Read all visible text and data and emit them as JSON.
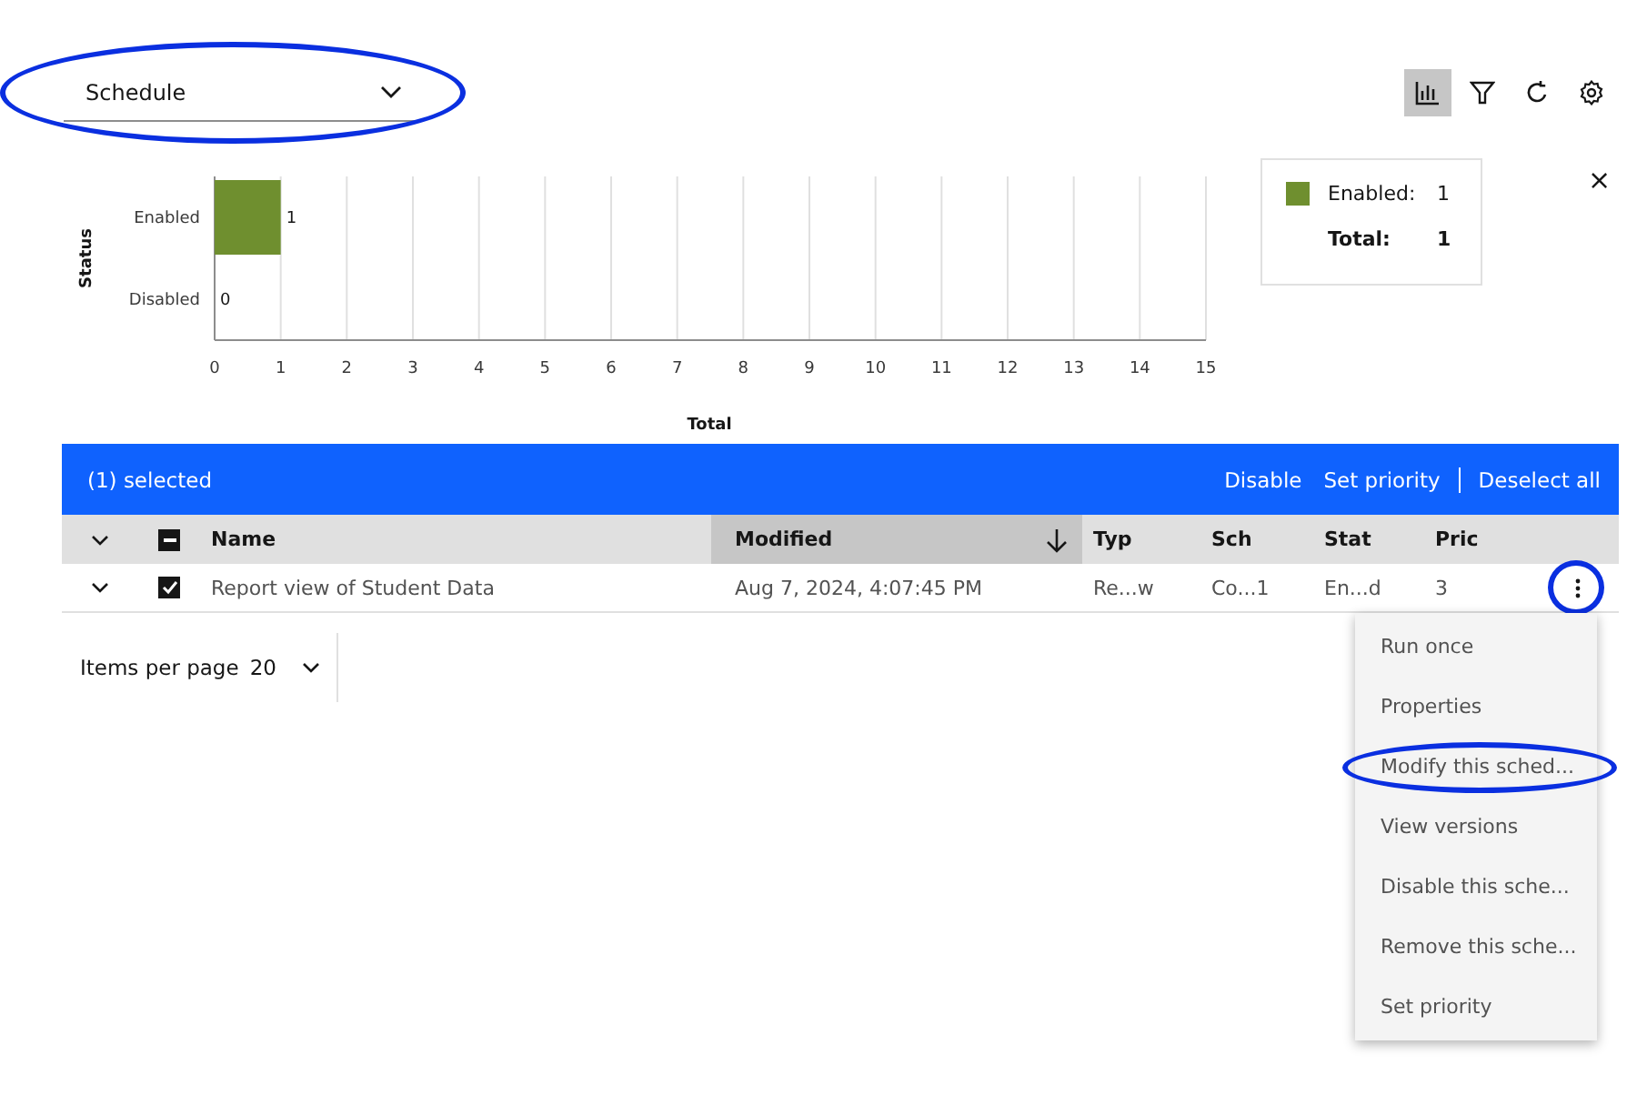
{
  "dropdown": {
    "value": "Schedule",
    "highlighted": true
  },
  "toolbar": [
    {
      "selected": true
    },
    {
      "selected": false
    },
    {
      "selected": false
    },
    {
      "selected": false
    }
  ],
  "chart": {
    "chart_data": {
      "type": "bar",
      "orientation": "horizontal",
      "xlabel": "Total",
      "ylabel": "Status",
      "categories": [
        "Enabled",
        "Disabled"
      ],
      "series": [
        {
          "color": "#6f8f2f",
          "values": [
            1,
            0
          ]
        }
      ],
      "grid": true,
      "xlim": [
        0,
        15
      ],
      "xticks": [
        0,
        1,
        2,
        3,
        4,
        5,
        6,
        7,
        8,
        9,
        10,
        11,
        12,
        13,
        14,
        15
      ],
      "data_labels": true
    }
  },
  "legend": {
    "items": [
      {
        "label": "Enabled:",
        "value": "1",
        "color": "#6f8f2f"
      }
    ],
    "total_label": "Total:",
    "total_value": "1"
  },
  "close_symbol": "×",
  "batch_bar": {
    "count": "(1) selected",
    "actions": [
      "Disable",
      "Set priority",
      "Deselect all"
    ]
  },
  "table": {
    "columns": [
      {
        "label": "Name",
        "sorted": false
      },
      {
        "label": "Modified",
        "sorted": true
      },
      {
        "label": "Typ",
        "sorted": false
      },
      {
        "label": "Sch",
        "sorted": false
      },
      {
        "label": "Stat",
        "sorted": false
      },
      {
        "label": "Pric",
        "sorted": false
      }
    ],
    "header_mixed": true,
    "rows": [
      {
        "checked": true,
        "cells": [
          "Report view of Student Data",
          "Aug 7, 2024, 4:07:45 PM",
          "Re...w",
          "Co...1",
          "En...d",
          "3"
        ],
        "menu_highlighted": true
      }
    ]
  },
  "pagination": {
    "label": "Items per page",
    "value": "20"
  },
  "menu": [
    {
      "label": "Run once",
      "highlighted": false
    },
    {
      "label": "Properties",
      "highlighted": false
    },
    {
      "label": "Modify this sched...",
      "highlighted": true
    },
    {
      "label": "View versions",
      "highlighted": false
    },
    {
      "label": "Disable this sche...",
      "highlighted": false
    },
    {
      "label": "Remove this sche...",
      "highlighted": false
    },
    {
      "label": "Set priority",
      "highlighted": false
    }
  ]
}
